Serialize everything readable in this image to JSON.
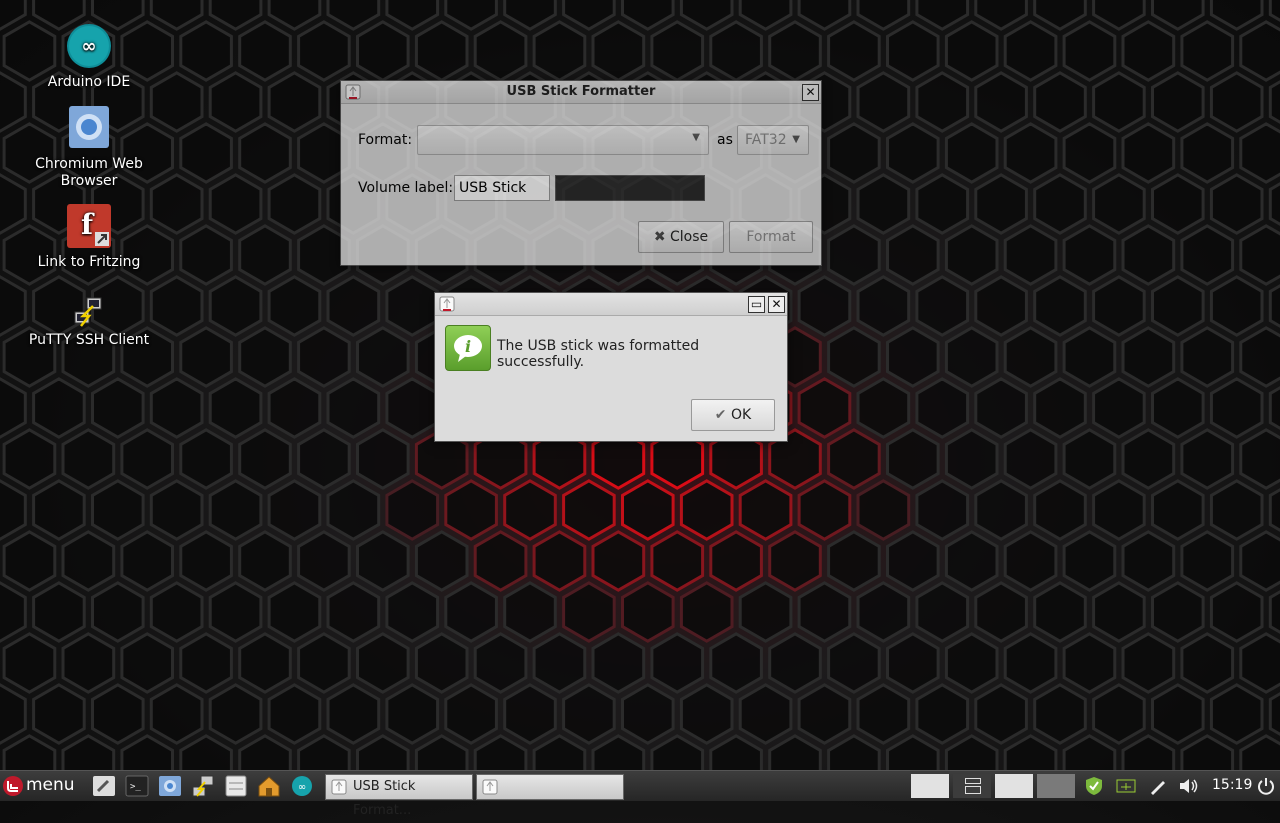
{
  "desktop_icons": [
    {
      "label": "Arduino IDE",
      "icon": "arduino-icon"
    },
    {
      "label": "Chromium Web\nBrowser",
      "icon": "chromium-icon"
    },
    {
      "label": "Link to Fritzing",
      "icon": "fritzing-icon"
    },
    {
      "label": "PuTTY SSH Client",
      "icon": "putty-icon"
    }
  ],
  "formatter": {
    "title": "USB Stick Formatter",
    "format_label": "Format:",
    "format_value": "",
    "as_label": "as",
    "fs_value": "FAT32",
    "volume_label": "Volume label:",
    "volume_value": "USB Stick",
    "close_button": "Close",
    "format_button": "Format"
  },
  "dialog": {
    "message": "The USB stick was formatted successfully.",
    "ok_button": "OK"
  },
  "taskbar": {
    "menu_label": "menu",
    "tasks": [
      "USB Stick Format...",
      ""
    ],
    "clock": "15:19"
  },
  "colors": {
    "accent_red": "#c0192b",
    "info_green": "#6ab23a"
  }
}
